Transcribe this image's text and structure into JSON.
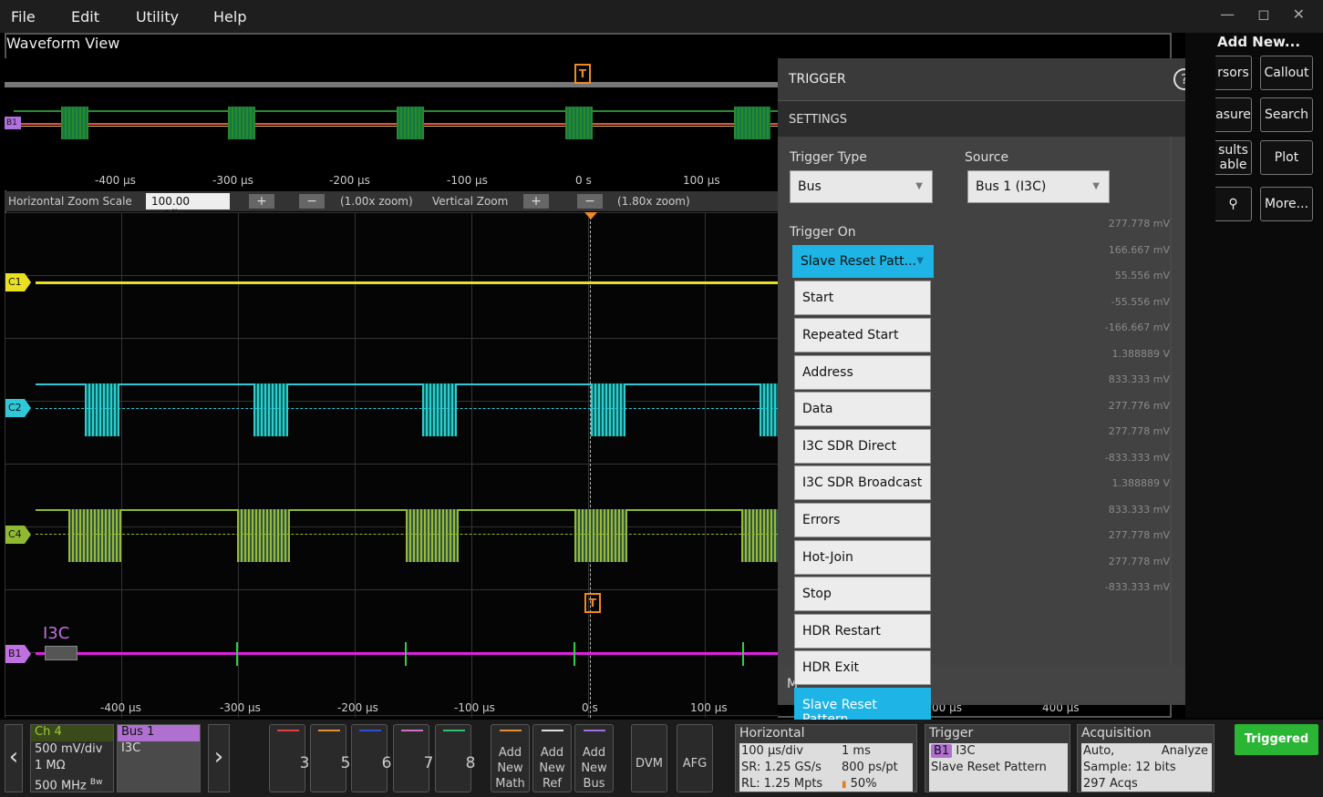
{
  "menu": [
    "File",
    "Edit",
    "Utility",
    "Help"
  ],
  "window_title": "Waveform View",
  "overview": {
    "tick_labels": [
      "-400 µs",
      "-300 µs",
      "-200 µs",
      "-100 µs",
      "0 s",
      "100 µs"
    ],
    "bus_tag": "B1",
    "trigger_marker": "T"
  },
  "zoom": {
    "h_label": "Horizontal Zoom Scale",
    "h_value": "100.00 us/div",
    "h_zoom": "(1.00x zoom)",
    "v_label": "Vertical Zoom",
    "v_zoom": "(1.80x zoom)",
    "plus": "+",
    "minus": "−"
  },
  "channels": [
    {
      "tag": "C1",
      "color": "#e8e020"
    },
    {
      "tag": "C2",
      "color": "#30c8d8"
    },
    {
      "tag": "C4",
      "color": "#90b830"
    },
    {
      "tag": "B1",
      "color": "#c070e0"
    }
  ],
  "bus_label": "I3C",
  "main_tick_labels": [
    "-400 µs",
    "-300 µs",
    "-200 µs",
    "-100 µs",
    "0 s",
    "100 µs"
  ],
  "main_tick_labels_right": [
    "00 µs",
    "400 µs"
  ],
  "scale_labels": [
    "277.778 mV",
    "166.667 mV",
    "55.556 mV",
    "-55.556 mV",
    "-166.667 mV",
    "1.388889 V",
    "833.333 mV",
    "277.776 mV",
    "277.778 mV",
    "-833.333 mV",
    "1.388889 V",
    "833.333 mV",
    "277.778 mV",
    "277.778 mV",
    "-833.333 mV"
  ],
  "trigger_panel": {
    "title": "TRIGGER",
    "help": "?",
    "section": "SETTINGS",
    "type_label": "Trigger Type",
    "type_value": "Bus",
    "source_label": "Source",
    "source_value": "Bus 1 (I3C)",
    "on_label": "Trigger On",
    "on_value": "Slave Reset Patt...",
    "collapsed_label": "M",
    "options": [
      "Start",
      "Repeated Start",
      "Address",
      "Data",
      "I3C SDR Direct",
      "I3C SDR Broadcast",
      "Errors",
      "Hot-Join",
      "Stop",
      "HDR Restart",
      "HDR Exit",
      "Slave Reset Pattern"
    ],
    "selected_option": "Slave Reset Pattern",
    "next_arrow": "›"
  },
  "right_panel": {
    "title": "Add New...",
    "buttons": [
      "rsors",
      "Callout",
      "asure",
      "Search",
      "sults\nable",
      "Plot",
      "",
      "More..."
    ]
  },
  "window_controls": "— ◻ ✕",
  "bottom": {
    "ch4": {
      "title": "Ch 4",
      "lines": [
        "500 mV/div",
        "1 MΩ",
        "500 MHz"
      ],
      "bw": "Bw"
    },
    "bus1": {
      "title": "Bus 1",
      "lines": [
        "I3C"
      ]
    },
    "channel_buttons": [
      {
        "n": "3",
        "color": "#e04040"
      },
      {
        "n": "5",
        "color": "#e09030"
      },
      {
        "n": "6",
        "color": "#3050d0"
      },
      {
        "n": "7",
        "color": "#d070c0"
      },
      {
        "n": "8",
        "color": "#30c070"
      }
    ],
    "add_buttons": [
      {
        "label": "Add\nNew\nMath",
        "color": "#e09030"
      },
      {
        "label": "Add\nNew\nRef",
        "color": "#dddddd"
      },
      {
        "label": "Add\nNew\nBus",
        "color": "#a070e0"
      }
    ],
    "dvm": "DVM",
    "afg": "AFG",
    "horizontal": {
      "title": "Horizontal",
      "rows": [
        [
          "100 µs/div",
          "1 ms"
        ],
        [
          "SR: 1.25 GS/s",
          "800 ps/pt"
        ],
        [
          "RL: 1.25 Mpts",
          "50%"
        ]
      ]
    },
    "trigger": {
      "title": "Trigger",
      "badge": "B1",
      "type": "I3C",
      "mode": "Slave Reset Pattern"
    },
    "acquisition": {
      "title": "Acquisition",
      "rows": [
        [
          "Auto,",
          "Analyze"
        ],
        [
          "Sample: 12 bits",
          ""
        ],
        [
          "297 Acqs",
          ""
        ]
      ]
    },
    "status": "Triggered",
    "prev": "‹",
    "next": "›"
  }
}
